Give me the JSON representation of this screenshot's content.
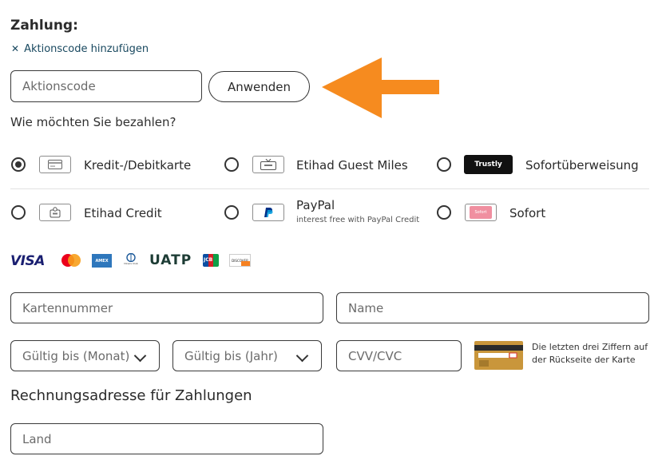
{
  "payment": {
    "title": "Zahlung:",
    "promo_toggle": {
      "icon": "close-icon",
      "label": "Aktionscode hinzufügen"
    },
    "promo_input": {
      "placeholder": "Aktionscode",
      "value": ""
    },
    "apply_label": "Anwenden",
    "question": "Wie möchten Sie bezahlen?"
  },
  "methods": [
    {
      "label": "Kredit-/Debitkarte",
      "icon": "credit-card-icon",
      "selected": true
    },
    {
      "label": "Etihad Guest Miles",
      "icon": "tv-miles-icon",
      "selected": false
    },
    {
      "label": "Sofortüberweisung",
      "icon": "trustly-logo",
      "badge": "Trustly",
      "selected": false
    },
    {
      "label": "Etihad Credit",
      "icon": "wallet-icon",
      "selected": false
    },
    {
      "label": "PayPal",
      "sublabel": "interest free with PayPal Credit",
      "icon": "paypal-icon",
      "selected": false
    },
    {
      "label": "Sofort",
      "icon": "sofort-logo",
      "badge": "Sofort",
      "selected": false
    }
  ],
  "card_brands": {
    "visa": "VISA",
    "amex": "AMEX",
    "diners": "Diners Club",
    "uatp": "UATP",
    "jcb": "JCB",
    "discover": "DISCOVER"
  },
  "card_form": {
    "card_number_placeholder": "Kartennummer",
    "name_placeholder": "Name",
    "month_placeholder": "Gültig bis (Monat)",
    "year_placeholder": "Gültig bis (Jahr)",
    "cvv_placeholder": "CVV/CVC",
    "cvv_hint": "Die letzten drei Ziffern auf der Rückseite der Karte"
  },
  "billing": {
    "title": "Rechnungsadresse für Zahlungen",
    "country_placeholder": "Land"
  },
  "colors": {
    "arrow": "#f68b1f",
    "link": "#18485f",
    "border": "#3a3a3a",
    "visa": "#1a1f71",
    "mastercard_red": "#eb001b",
    "mastercard_yellow": "#f79e1b",
    "amex": "#2e77bc",
    "sofort_pink": "#f08fa0"
  }
}
